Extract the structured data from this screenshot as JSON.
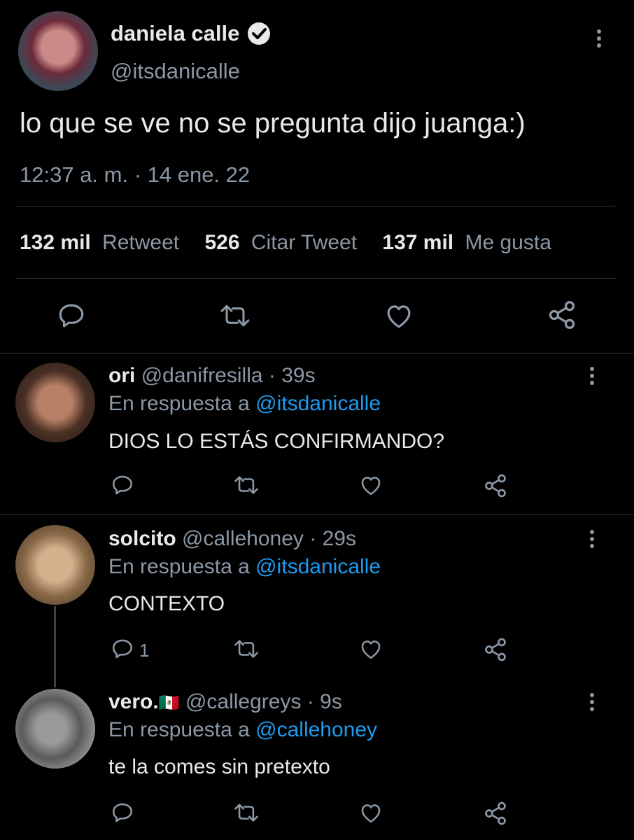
{
  "colors": {
    "background": "#000000",
    "text": "#e7e9ea",
    "muted": "#8b98a5",
    "link": "#1d9bf0",
    "divider": "#2f3336"
  },
  "main_tweet": {
    "display_name": "daniela calle",
    "handle": "@itsdanicalle",
    "verified": true,
    "text": "lo que se ve no se pregunta dijo juanga:)",
    "timestamp": "12:37 a. m. · 14 ene. 22",
    "stats": {
      "retweets_count": "132 mil",
      "retweets_label": "Retweet",
      "quotes_count": "526",
      "quotes_label": "Citar Tweet",
      "likes_count": "137 mil",
      "likes_label": "Me gusta"
    },
    "actions": [
      "reply-icon",
      "retweet-icon",
      "like-icon",
      "share-icon"
    ]
  },
  "replies": [
    {
      "name": "ori",
      "handle": "@danifresilla",
      "time": "· 39s",
      "reply_prefix": "En respuesta a",
      "reply_to": "@itsdanicalle",
      "text": "DIOS LO ESTÁS CONFIRMANDO?",
      "reply_count": ""
    },
    {
      "name": "solcito",
      "handle": "@callehoney",
      "time": "· 29s",
      "reply_prefix": "En respuesta a",
      "reply_to": "@itsdanicalle",
      "text": "CONTEXTO",
      "reply_count": "1"
    },
    {
      "name": "vero.",
      "flag": "🇲🇽",
      "handle": "@callegreys",
      "time": "· 9s",
      "reply_prefix": "En respuesta a",
      "reply_to": "@callehoney",
      "text": "te la comes sin pretexto",
      "reply_count": ""
    }
  ]
}
